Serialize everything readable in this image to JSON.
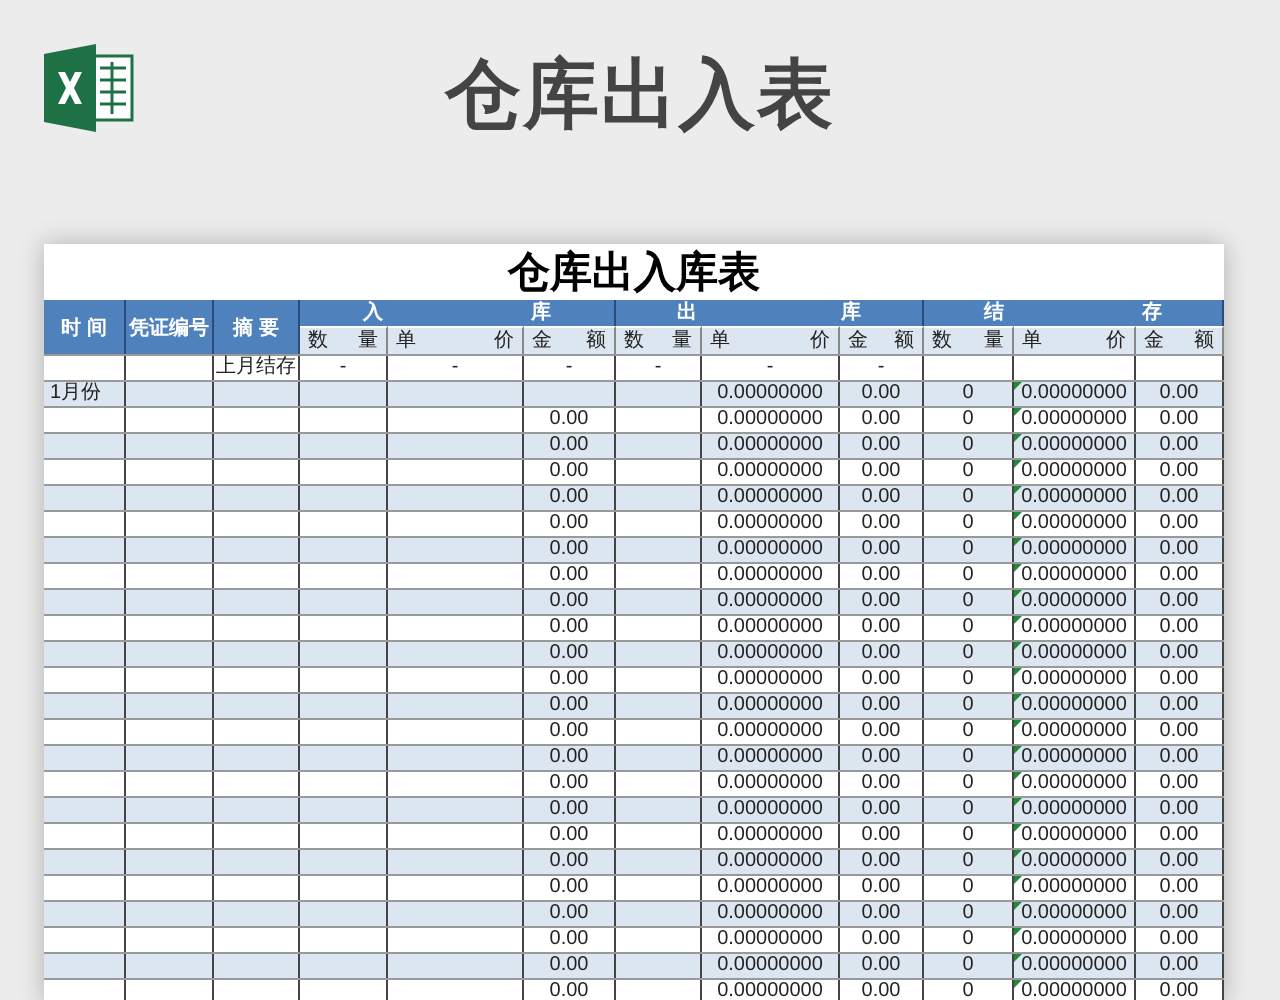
{
  "page_title": "仓库出入表",
  "sheet": {
    "title": "仓库出入库表",
    "headers": {
      "time": "时 间",
      "voucher": "凭证编号",
      "summary": "摘 要",
      "groups": [
        "入 库",
        "出 库",
        "结 存"
      ],
      "sub": [
        "数 量",
        "单 价",
        "金 额",
        "数 量",
        "单 价",
        "金 额",
        "数 量",
        "单 价",
        "金 额"
      ]
    },
    "rows": [
      {
        "summary": "上月结存",
        "in_qty": "-",
        "in_price": "-",
        "in_amount": "-",
        "out_qty": "-",
        "out_price": "-",
        "out_amount": "-"
      },
      {
        "time": "1月份",
        "out_price": "0.00000000",
        "out_amount": "0.00",
        "bal_qty": "0",
        "bal_price": "0.00000000",
        "bal_amount": "0.00"
      },
      {
        "in_amount": "0.00",
        "out_price": "0.00000000",
        "out_amount": "0.00",
        "bal_qty": "0",
        "bal_price": "0.00000000",
        "bal_amount": "0.00"
      },
      {
        "in_amount": "0.00",
        "out_price": "0.00000000",
        "out_amount": "0.00",
        "bal_qty": "0",
        "bal_price": "0.00000000",
        "bal_amount": "0.00"
      },
      {
        "in_amount": "0.00",
        "out_price": "0.00000000",
        "out_amount": "0.00",
        "bal_qty": "0",
        "bal_price": "0.00000000",
        "bal_amount": "0.00"
      },
      {
        "in_amount": "0.00",
        "out_price": "0.00000000",
        "out_amount": "0.00",
        "bal_qty": "0",
        "bal_price": "0.00000000",
        "bal_amount": "0.00"
      },
      {
        "in_amount": "0.00",
        "out_price": "0.00000000",
        "out_amount": "0.00",
        "bal_qty": "0",
        "bal_price": "0.00000000",
        "bal_amount": "0.00"
      },
      {
        "in_amount": "0.00",
        "out_price": "0.00000000",
        "out_amount": "0.00",
        "bal_qty": "0",
        "bal_price": "0.00000000",
        "bal_amount": "0.00"
      },
      {
        "in_amount": "0.00",
        "out_price": "0.00000000",
        "out_amount": "0.00",
        "bal_qty": "0",
        "bal_price": "0.00000000",
        "bal_amount": "0.00"
      },
      {
        "in_amount": "0.00",
        "out_price": "0.00000000",
        "out_amount": "0.00",
        "bal_qty": "0",
        "bal_price": "0.00000000",
        "bal_amount": "0.00"
      },
      {
        "in_amount": "0.00",
        "out_price": "0.00000000",
        "out_amount": "0.00",
        "bal_qty": "0",
        "bal_price": "0.00000000",
        "bal_amount": "0.00"
      },
      {
        "in_amount": "0.00",
        "out_price": "0.00000000",
        "out_amount": "0.00",
        "bal_qty": "0",
        "bal_price": "0.00000000",
        "bal_amount": "0.00"
      },
      {
        "in_amount": "0.00",
        "out_price": "0.00000000",
        "out_amount": "0.00",
        "bal_qty": "0",
        "bal_price": "0.00000000",
        "bal_amount": "0.00"
      },
      {
        "in_amount": "0.00",
        "out_price": "0.00000000",
        "out_amount": "0.00",
        "bal_qty": "0",
        "bal_price": "0.00000000",
        "bal_amount": "0.00"
      },
      {
        "in_amount": "0.00",
        "out_price": "0.00000000",
        "out_amount": "0.00",
        "bal_qty": "0",
        "bal_price": "0.00000000",
        "bal_amount": "0.00"
      },
      {
        "in_amount": "0.00",
        "out_price": "0.00000000",
        "out_amount": "0.00",
        "bal_qty": "0",
        "bal_price": "0.00000000",
        "bal_amount": "0.00"
      },
      {
        "in_amount": "0.00",
        "out_price": "0.00000000",
        "out_amount": "0.00",
        "bal_qty": "0",
        "bal_price": "0.00000000",
        "bal_amount": "0.00"
      },
      {
        "in_amount": "0.00",
        "out_price": "0.00000000",
        "out_amount": "0.00",
        "bal_qty": "0",
        "bal_price": "0.00000000",
        "bal_amount": "0.00"
      },
      {
        "in_amount": "0.00",
        "out_price": "0.00000000",
        "out_amount": "0.00",
        "bal_qty": "0",
        "bal_price": "0.00000000",
        "bal_amount": "0.00"
      },
      {
        "in_amount": "0.00",
        "out_price": "0.00000000",
        "out_amount": "0.00",
        "bal_qty": "0",
        "bal_price": "0.00000000",
        "bal_amount": "0.00"
      },
      {
        "in_amount": "0.00",
        "out_price": "0.00000000",
        "out_amount": "0.00",
        "bal_qty": "0",
        "bal_price": "0.00000000",
        "bal_amount": "0.00"
      },
      {
        "in_amount": "0.00",
        "out_price": "0.00000000",
        "out_amount": "0.00",
        "bal_qty": "0",
        "bal_price": "0.00000000",
        "bal_amount": "0.00"
      },
      {
        "in_amount": "0.00",
        "out_price": "0.00000000",
        "out_amount": "0.00",
        "bal_qty": "0",
        "bal_price": "0.00000000",
        "bal_amount": "0.00"
      },
      {
        "in_amount": "0.00",
        "out_price": "0.00000000",
        "out_amount": "0.00",
        "bal_qty": "0",
        "bal_price": "0.00000000",
        "bal_amount": "0.00"
      },
      {
        "in_amount": "0.00",
        "out_price": "0.00000000",
        "out_amount": "0.00",
        "bal_qty": "0",
        "bal_price": "0.00000000",
        "bal_amount": "0.00"
      }
    ]
  }
}
